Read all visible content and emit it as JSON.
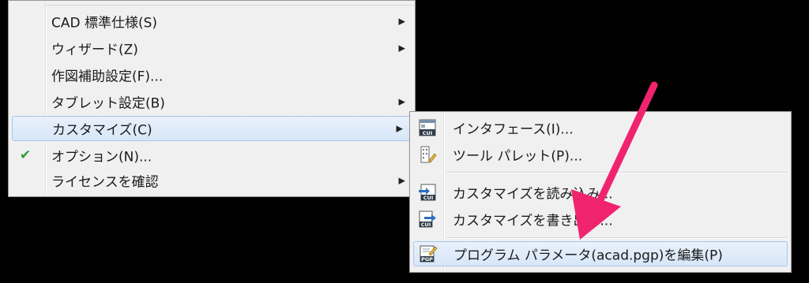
{
  "menu_main": {
    "items": [
      {
        "label": "CAD 標準仕様(S)",
        "submenu": true
      },
      {
        "label": "ウィザード(Z)",
        "submenu": true
      },
      {
        "label": "作図補助設定(F)...",
        "submenu": false
      },
      {
        "label": "タブレット設定(B)",
        "submenu": true
      },
      {
        "label": "カスタマイズ(C)",
        "submenu": true,
        "highlighted": true
      },
      {
        "label": "オプション(N)...",
        "submenu": false,
        "checked": true
      },
      {
        "label": "ライセンスを確認",
        "submenu": true
      }
    ],
    "arrow_glyph": "▶",
    "check_glyph": "✔"
  },
  "menu_customize": {
    "items": [
      {
        "label": "インタフェース(I)...",
        "icon": "cui-icon"
      },
      {
        "label": "ツール パレット(P)...",
        "icon": "tool-palette-icon"
      },
      {
        "label": "カスタマイズを読み込み...",
        "icon": "cui-import-icon"
      },
      {
        "label": "カスタマイズを書き出し...",
        "icon": "cui-export-icon"
      },
      {
        "label": "プログラム パラメータ(acad.pgp)を編集(P)",
        "icon": "pgp-edit-icon",
        "highlighted": true
      }
    ],
    "icon_text_cui": "CUI",
    "icon_text_pgp": "PGP"
  },
  "colors": {
    "background": "#000000",
    "menu_bg": "#f0f0f0",
    "highlight_border": "#a8c6ee",
    "annotation_arrow": "#f0246e",
    "check": "#2a9d3a"
  }
}
